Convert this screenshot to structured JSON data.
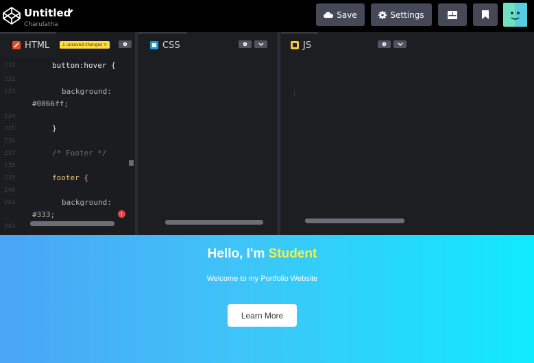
{
  "header": {
    "title": "Untitled",
    "owner": "Charulatha",
    "save_label": "Save",
    "settings_label": "Settings"
  },
  "editors": {
    "html": {
      "label": "HTML",
      "badge": "1 unsaved changes ×",
      "lines": [
        {
          "num": "231",
          "text": "button:hover {",
          "kind": "sel"
        },
        {
          "num": "232",
          "text": "",
          "kind": "blank"
        },
        {
          "num": "233",
          "text": "background:",
          "kind": "prop"
        },
        {
          "num": "",
          "text": "#0066ff;",
          "kind": "prop"
        },
        {
          "num": "234",
          "text": "",
          "kind": "blank"
        },
        {
          "num": "235",
          "text": "}",
          "kind": "sel"
        },
        {
          "num": "236",
          "text": "",
          "kind": "blank"
        },
        {
          "num": "237",
          "text": "/* Footer */",
          "kind": "cmt"
        },
        {
          "num": "238",
          "text": "",
          "kind": "blank"
        },
        {
          "num": "239",
          "text": "footer {",
          "kind": "footer"
        },
        {
          "num": "240",
          "text": "",
          "kind": "blank"
        },
        {
          "num": "241",
          "text": "background:",
          "kind": "prop"
        },
        {
          "num": "",
          "text": "#333;",
          "kind": "prop"
        },
        {
          "num": "242",
          "text": "",
          "kind": "blank"
        }
      ],
      "error_count": "!"
    },
    "css": {
      "label": "CSS"
    },
    "js": {
      "label": "JS"
    }
  },
  "preview": {
    "hero_prefix": "Hello, I'm ",
    "hero_name": "Student",
    "subtitle": "Welcome to my Portfolio Website",
    "button_label": "Learn More"
  },
  "icons": {
    "logo": "codepen-logo-icon",
    "edit": "pencil-icon",
    "save": "cloud-icon",
    "settings": "gear-icon",
    "layout": "layout-icon",
    "pin": "bookmark-icon",
    "avatar": "user-avatar"
  },
  "colors": {
    "topbar": "#000000",
    "button": "#444857",
    "html_tab": "#e44d26",
    "css_tab": "#1e9bd7",
    "js_tab": "#f7c93e",
    "badge": "#ffdd40",
    "highlight_name": "#f5f044"
  }
}
